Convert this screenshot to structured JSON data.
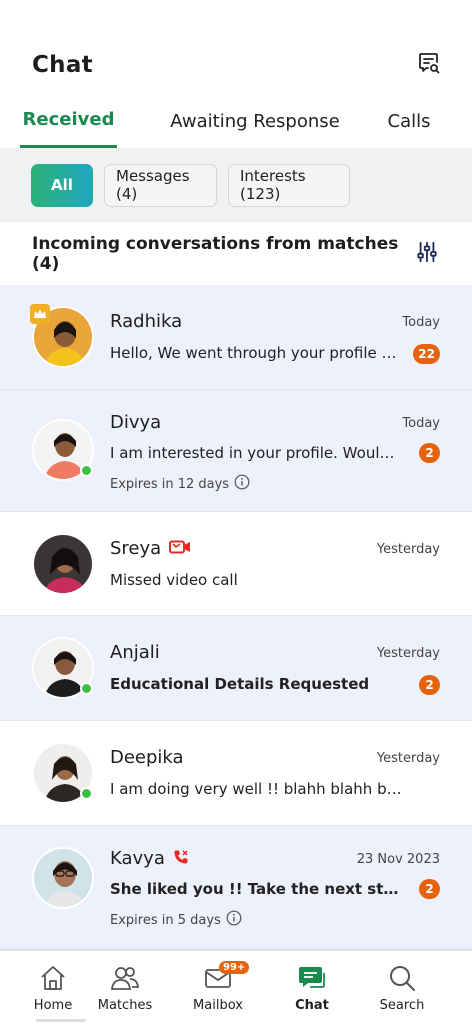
{
  "header": {
    "title": "Chat",
    "search_icon": "chat-search-icon"
  },
  "tabs": [
    {
      "label": "Received",
      "active": true
    },
    {
      "label": "Awaiting Response",
      "active": false
    },
    {
      "label": "Calls",
      "active": false
    }
  ],
  "filters": [
    {
      "label": "All",
      "active": true
    },
    {
      "label": "Messages (4)",
      "active": false
    },
    {
      "label": "Interests (123)",
      "active": false
    }
  ],
  "section": {
    "title": "Incoming conversations from matches (4)",
    "filter_icon": "sliders-icon"
  },
  "conversations": [
    {
      "name": "Radhika",
      "time": "Today",
      "preview": "Hello, We went through your profile a...",
      "badge": "22",
      "unread": true,
      "online": false,
      "premium": true,
      "bold": false
    },
    {
      "name": "Divya",
      "time": "Today",
      "preview": "I am interested in your profile. Would...",
      "badge": "2",
      "expiry": "Expires in 12 days",
      "unread": true,
      "online": true,
      "premium": false,
      "bold": false
    },
    {
      "name": "Sreya",
      "time": "Yesterday",
      "preview": "Missed video call",
      "name_icon": "missed-video-call-icon",
      "unread": false,
      "online": false,
      "premium": false,
      "bold": false
    },
    {
      "name": "Anjali",
      "time": "Yesterday",
      "preview": "Educational Details Requested",
      "badge": "2",
      "unread": true,
      "online": true,
      "premium": false,
      "bold": true
    },
    {
      "name": "Deepika",
      "time": "Yesterday",
      "preview": "I am doing very well !! blahh blahh blah...",
      "unread": false,
      "online": true,
      "premium": false,
      "bold": false
    },
    {
      "name": "Kavya",
      "time": "23 Nov 2023",
      "preview": "She liked you !! Take the next step...",
      "badge": "2",
      "expiry": "Expires in 5 days",
      "name_icon": "missed-call-icon",
      "unread": true,
      "online": false,
      "premium": false,
      "bold": true
    }
  ],
  "bottom_nav": [
    {
      "label": "Home",
      "icon": "home-icon",
      "active": false
    },
    {
      "label": "Matches",
      "icon": "matches-icon",
      "active": false
    },
    {
      "label": "Mailbox",
      "icon": "mailbox-icon",
      "badge": "99+",
      "active": false
    },
    {
      "label": "Chat",
      "icon": "chat-icon",
      "active": true
    },
    {
      "label": "Search",
      "icon": "search-icon",
      "active": false
    }
  ],
  "colors": {
    "accent": "#1b8a4f",
    "badge": "#e6630d",
    "unread_bg": "#eef0fb",
    "online": "#3fbe44"
  }
}
